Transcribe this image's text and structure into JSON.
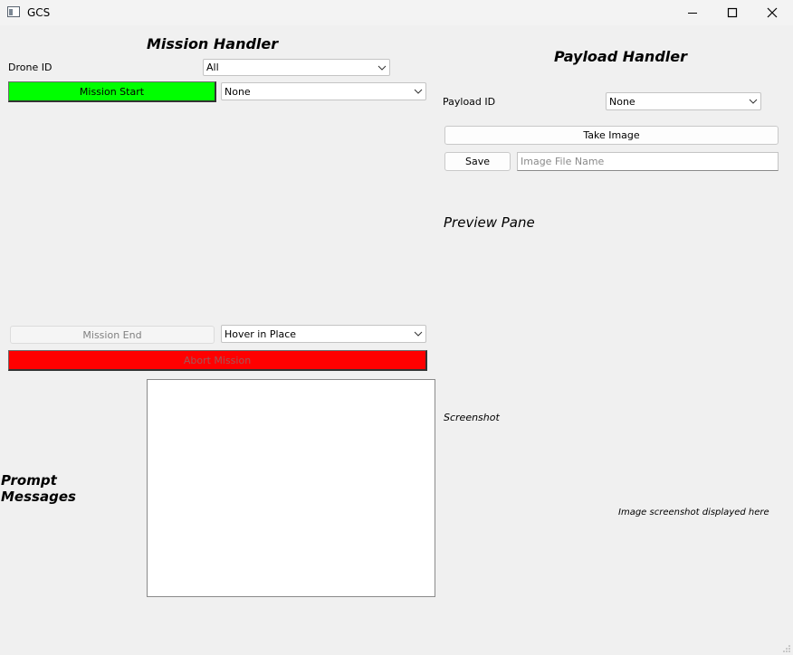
{
  "window": {
    "title": "GCS",
    "icon": "app-window-icon",
    "controls": [
      "minimize-icon",
      "maximize-icon",
      "close-icon"
    ]
  },
  "mission": {
    "heading": "Mission Handler",
    "drone_id_label": "Drone ID",
    "drone_id_value": "All",
    "start_label": "Mission Start",
    "start_mission_value": "None",
    "end_label": "Mission End",
    "end_action_value": "Hover in Place",
    "abort_label": "Abort Mission",
    "start_color": "#00ff00",
    "abort_color": "#ff0000"
  },
  "prompt": {
    "label_line1": "Prompt",
    "label_line2": "Messages",
    "content": ""
  },
  "payload": {
    "heading": "Payload Handler",
    "payload_id_label": "Payload ID",
    "payload_id_value": "None",
    "take_image_label": "Take Image",
    "save_label": "Save",
    "file_name_placeholder": "Image File Name",
    "preview_heading": "Preview Pane",
    "screenshot_label": "Screenshot",
    "screenshot_placeholder": "Image screenshot displayed here"
  }
}
